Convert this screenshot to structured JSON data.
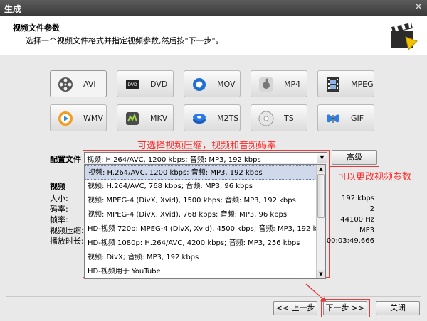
{
  "window": {
    "title": "生成",
    "close": "✕"
  },
  "header": {
    "title": "视频文件参数",
    "subtitle": "选择一个视频文件格式并指定视频参数,然后按\"下一步\"。"
  },
  "formats": [
    {
      "label": "AVI",
      "icon": "film-reel-icon",
      "selected": true
    },
    {
      "label": "DVD",
      "icon": "dvd-icon"
    },
    {
      "label": "MOV",
      "icon": "quicktime-icon"
    },
    {
      "label": "MP4",
      "icon": "apple-icon"
    },
    {
      "label": "MPEG",
      "icon": "filmstrip-icon"
    },
    {
      "label": "WMV",
      "icon": "media-player-icon"
    },
    {
      "label": "MKV",
      "icon": "mkv-icon"
    },
    {
      "label": "M2TS",
      "icon": "bluray-icon"
    },
    {
      "label": "TS",
      "icon": "disc-icon"
    },
    {
      "label": "GIF",
      "icon": "butterfly-icon"
    }
  ],
  "annotations": {
    "compress": "可选择视频压缩，视频和音频码率",
    "params": "可以更改视频参数"
  },
  "profile": {
    "label": "配置文件",
    "value": "视频: H.264/AVC, 1200 kbps; 音频: MP3, 192 kbps",
    "advanced_label": "高级",
    "options": [
      "视频: H.264/AVC, 1200 kbps; 音频: MP3, 192 kbps",
      "视频: H.264/AVC, 768 kbps; 音频: MP3, 96 kbps",
      "视频: MPEG-4 (DivX, Xvid), 1500 kbps; 音频: MP3, 192 kbps",
      "视频: MPEG-4 (DivX, Xvid), 768 kbps; 音频: MP3, 96 kbps",
      "HD-视频 720p: MPEG-4 (DivX, Xvid), 4500 kbps; 音频: MP3, 192 kbps",
      "HD-视频 1080p: H.264/AVC, 4200 kbps; 音频: MP3, 256 kbps",
      "视频: DivX; 音频: MP3, 192 kbps",
      "HD-视频用于 YouTube"
    ]
  },
  "video_section": {
    "title": "视频",
    "labels": [
      "大小:",
      "码率:",
      "帧率:",
      "视频压缩:",
      "播放时长:"
    ]
  },
  "audio_values": [
    "192 kbps",
    "2",
    "44100 Hz",
    "MP3",
    "00:03:49.666"
  ],
  "nav": {
    "back": "<< 上一步",
    "next": "下一步 >>",
    "close": "关闭"
  },
  "colors": {
    "annotation": "#ff2a2a",
    "highlight": "#cfd9ea"
  }
}
